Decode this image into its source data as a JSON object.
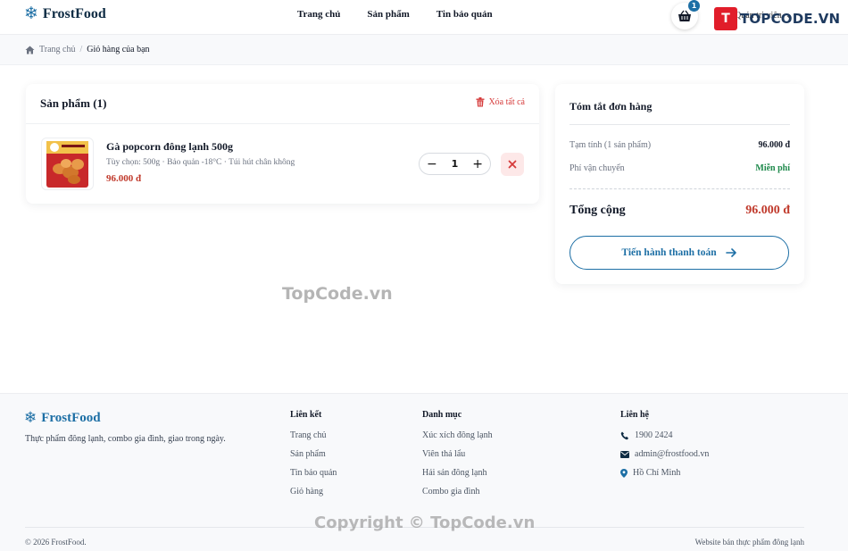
{
  "header": {
    "brand": "FrostFood",
    "nav": [
      "Trang chủ",
      "Sản phẩm",
      "Tin bảo quản"
    ],
    "cart_count": "1",
    "user_label": "Quản trị viên"
  },
  "watermark": {
    "logo_text": "TOPCODE.VN",
    "center": "TopCode.vn",
    "copyright": "Copyright © TopCode.vn"
  },
  "breadcrumb": {
    "home": "Trang chủ",
    "separator": "/",
    "current": "Giỏ hàng của bạn"
  },
  "products": {
    "title": "Sản phẩm (1)",
    "clear_all": "Xóa tất cả",
    "items": [
      {
        "name": "Gà popcorn đông lạnh 500g",
        "options": "Tùy chọn: 500g · Bảo quản -18°C · Túi hút chân không",
        "price": "96.000 đ",
        "quantity": "1"
      }
    ]
  },
  "summary": {
    "title": "Tóm tắt đơn hàng",
    "subtotal_label": "Tạm tính (1 sản phẩm)",
    "subtotal_value": "96.000 đ",
    "shipping_label": "Phí vận chuyển",
    "shipping_value": "Miễn phí",
    "total_label": "Tổng cộng",
    "total_value": "96.000 đ",
    "checkout_label": "Tiến hành thanh toán"
  },
  "footer": {
    "brand": "FrostFood",
    "description": "Thực phẩm đông lạnh, combo gia đình, giao trong ngày.",
    "links_title": "Liên kết",
    "links": [
      "Trang chủ",
      "Sản phẩm",
      "Tin bảo quản",
      "Giỏ hàng"
    ],
    "categories_title": "Danh mục",
    "categories": [
      "Xúc xích đông lạnh",
      "Viên thả lẩu",
      "Hải sản đông lạnh",
      "Combo gia đình"
    ],
    "contact_title": "Liên hệ",
    "phone": "1900 2424",
    "email": "admin@frostfood.vn",
    "location": "Hồ Chí Minh",
    "copyright": "© 2026 FrostFood.",
    "tagline": "Website bán thực phẩm đông lạnh"
  },
  "colors": {
    "brand": "#1d6fa5",
    "price": "#c0392b",
    "free": "#1f8a4c",
    "danger": "#d63b3b"
  }
}
